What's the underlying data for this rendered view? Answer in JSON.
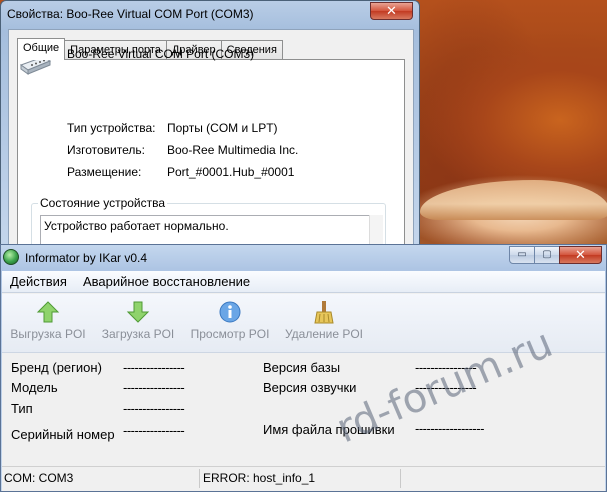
{
  "properties_dialog": {
    "title": "Свойства: Boo-Ree Virtual COM Port (COM3)",
    "close_glyph": "✕",
    "tabs": [
      {
        "label": "Общие",
        "active": true
      },
      {
        "label": "Параметры порта",
        "active": false
      },
      {
        "label": "Драйвер",
        "active": false
      },
      {
        "label": "Сведения",
        "active": false
      }
    ],
    "device_name": "Boo-Ree Virtual COM Port (COM3)",
    "info": [
      {
        "key": "Тип устройства:",
        "value": "Порты (COM и LPT)"
      },
      {
        "key": "Изготовитель:",
        "value": "Boo-Ree Multimedia Inc."
      },
      {
        "key": "Размещение:",
        "value": "Port_#0001.Hub_#0001"
      }
    ],
    "status_legend": "Состояние устройства",
    "status_text": "Устройство работает нормально."
  },
  "informator": {
    "title": "Informator by IKar v0.4",
    "window_buttons": {
      "minimize": "▭",
      "maximize": "▢",
      "close": "✕"
    },
    "menu": [
      "Действия",
      "Аварийное восстановление"
    ],
    "toolbar": [
      {
        "label": "Выгрузка POI",
        "icon": "arrow-up-icon",
        "color": "#6cc04a"
      },
      {
        "label": "Загрузка POI",
        "icon": "arrow-down-icon",
        "color": "#6cc04a"
      },
      {
        "label": "Просмотр POI",
        "icon": "info-icon",
        "color": "#4a8fd8"
      },
      {
        "label": "Удаление POI",
        "icon": "broom-icon",
        "color": "#c9a23a"
      }
    ],
    "fields_left": [
      {
        "label": "Бренд (регион)",
        "value": "----------------"
      },
      {
        "label": "Модель",
        "value": "----------------"
      },
      {
        "label": "Тип",
        "value": "----------------"
      },
      {
        "label": "Серийный номер",
        "value": "----------------"
      }
    ],
    "fields_right": [
      {
        "label": "Версия базы",
        "value": "----------------"
      },
      {
        "label": "Версия озвучки",
        "value": "----------------"
      },
      {
        "label": "Имя файла прошивки",
        "value": "------------------"
      }
    ],
    "statusbar": [
      "COM: COM3",
      "ERROR: host_info_1"
    ]
  },
  "watermark": "rd-forum.ru"
}
